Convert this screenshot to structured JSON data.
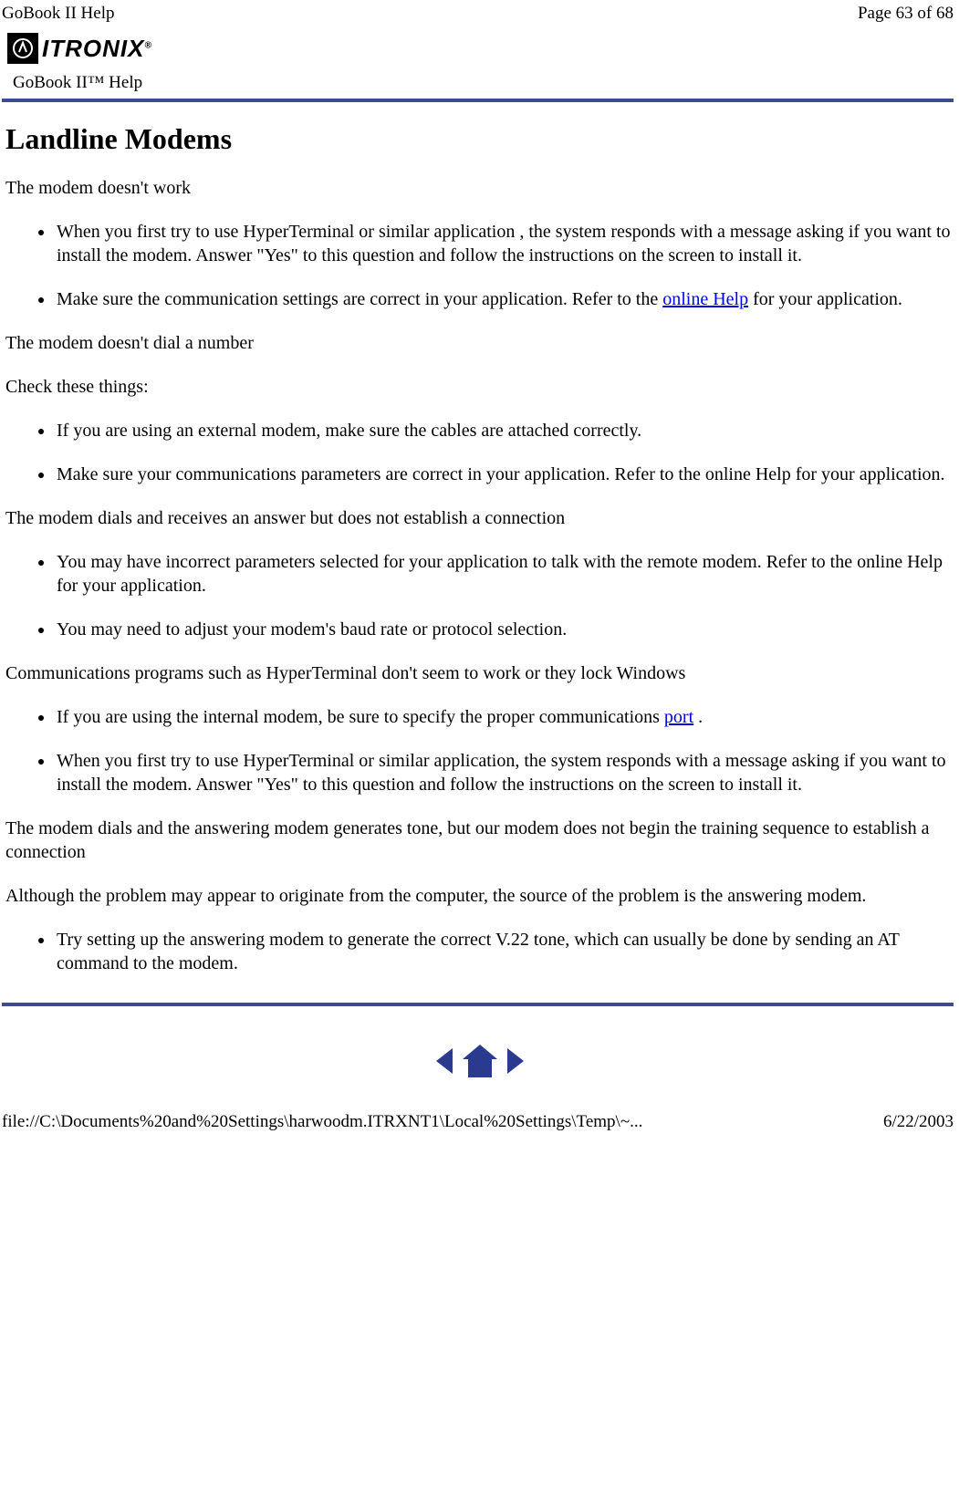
{
  "header": {
    "title": "GoBook II Help",
    "page_indicator": "Page 63 of 68"
  },
  "logo": {
    "brand": "ITRONIX",
    "reg": "®"
  },
  "subtitle": "GoBook II™ Help",
  "main": {
    "heading": "Landline Modems",
    "section1": {
      "title": "The modem doesn't work",
      "items": [
        "When you first try to use HyperTerminal or similar application , the system responds with a message asking if you want to install the modem. Answer \"Yes\" to this question and follow the instructions on the screen to install it."
      ],
      "item2_pre": "Make sure the communication settings are correct in your application. Refer to the ",
      "item2_link": "online Help",
      "item2_post": " for your application."
    },
    "section2": {
      "title": "The modem doesn't dial a number",
      "subtitle": "Check these things:",
      "items": [
        "If you are using an external modem, make sure the cables are attached correctly.",
        "Make sure your communications parameters are correct in your application. Refer to the online Help for your application."
      ]
    },
    "section3": {
      "title": "The modem dials and receives an answer but does not establish a connection",
      "items": [
        "You may have incorrect parameters selected for your application to talk with the remote modem. Refer to the online Help for your application.",
        "You may need to adjust your modem's baud rate or protocol selection."
      ]
    },
    "section4": {
      "title": "Communications programs such as HyperTerminal don't seem to work or they lock Windows",
      "item1_pre": "If you are using the internal modem, be sure to specify the proper communications ",
      "item1_link": "port",
      "item1_post": " .",
      "items": [
        "When you first try to use HyperTerminal or similar application, the system responds with a message asking if you want to install the modem. Answer \"Yes\" to this question and follow the instructions on the screen to install it."
      ]
    },
    "section5": {
      "title": "The modem dials and the answering modem generates tone, but our modem does not begin the training sequence to establish a connection",
      "subtitle": "Although the problem may appear to originate from the computer, the source of the problem is the answering modem.",
      "items": [
        "Try setting up the answering modem to generate the correct V.22 tone, which can usually be done by sending an AT command to the modem."
      ]
    }
  },
  "footer": {
    "path": "file://C:\\Documents%20and%20Settings\\harwoodm.ITRXNT1\\Local%20Settings\\Temp\\~...",
    "date": "6/22/2003"
  }
}
